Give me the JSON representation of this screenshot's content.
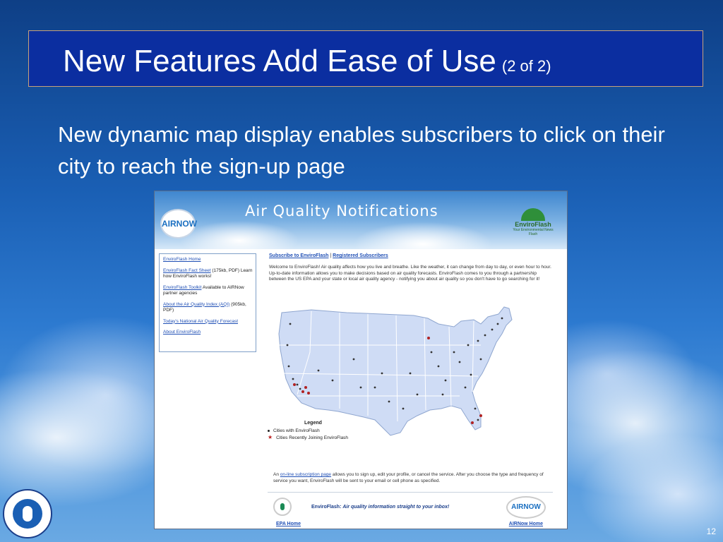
{
  "slide": {
    "title": "New Features Add Ease of Use",
    "title_suffix": "(2 of 2)",
    "subtitle": "New dynamic map display enables subscribers to click on their city to reach the sign-up page",
    "page_number": "12"
  },
  "screenshot": {
    "header_title": "Air Quality Notifications",
    "airnow_logo": "AIRNOW",
    "enviroflash_logo": "EnviroFlash",
    "enviroflash_tagline": "Your Environmental News Flash",
    "sidebar": {
      "links": [
        {
          "link": "EnviroFlash Home",
          "note": ""
        },
        {
          "link": "EnviroFlash Fact Sheet",
          "note": " (175kb, PDF) Learn how EnviroFlash works!"
        },
        {
          "link": "EnviroFlash Toolkit",
          "note": " Available to AIRNow partner agencies"
        },
        {
          "link": "About the Air Quality Index (AQI)",
          "note": " (905kb, PDF)"
        },
        {
          "link": "Today's National Air Quality Forecast",
          "note": ""
        },
        {
          "link": "About EnviroFlash",
          "note": ""
        }
      ]
    },
    "top_links": {
      "subscribe": "Subscribe to EnviroFlash",
      "separator": "|",
      "registered": "Registered Subscribers"
    },
    "welcome_text": "Welcome to EnviroFlash! Air quality affects how you live and breathe. Like the weather, it can change from day to day, or even hour to hour. Up-to-date information allows you to make decisions based on air quality forecasts. EnviroFlash comes to you through a partnership between the US EPA and your state or local air quality agency - notifying you about air quality so you don't have to go searching for it!",
    "legend": {
      "title": "Legend",
      "item_cities": "Cities with EnviroFlash",
      "item_recent": "Cities Recently Joining EnviroFlash"
    },
    "bottom_text": {
      "prefix": "An ",
      "link": "on-line subscription page",
      "rest": " allows you to sign up, edit your profile, or cancel the service. After you choose the type and frequency of service you want, EnviroFlash will be sent to your email or cell phone as specified."
    },
    "footer": {
      "tagline_brand": "EnviroFlash:",
      "tagline_text": "Air quality information straight to your inbox!",
      "epa_home": "EPA Home",
      "airnow_home": "AIRNow Home",
      "airnow_small": "AIRNOW"
    }
  },
  "colors": {
    "title_bar": "#0b2ea0",
    "link_blue": "#1f4fb5",
    "map_state": "#cfdcf5",
    "city_dot": "#333333",
    "recent_star": "#b22222"
  }
}
